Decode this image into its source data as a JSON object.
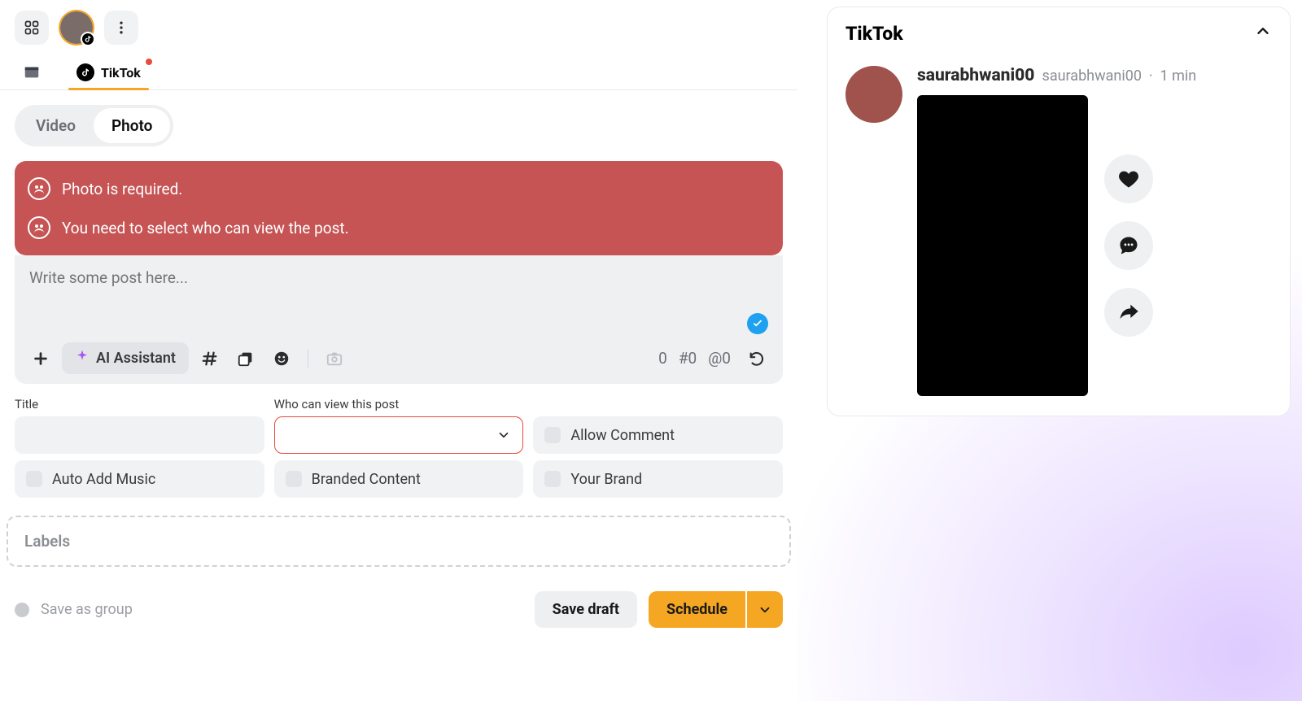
{
  "header": {
    "grid_label": "Accounts grid"
  },
  "tabs": {
    "calendar_icon": "calendar",
    "active": "TikTok"
  },
  "content_type": {
    "video": "Video",
    "photo": "Photo",
    "active": "Photo"
  },
  "errors": [
    "Photo is required.",
    "You need to select who can view the post."
  ],
  "composer": {
    "placeholder": "Write some post here...",
    "ai_button": "AI Assistant",
    "counts": {
      "chars": "0",
      "hash": "#0",
      "at": "@0"
    }
  },
  "form": {
    "title_label": "Title",
    "view_label": "Who can view this post",
    "allow_comment": "Allow Comment",
    "auto_add_music": "Auto Add Music",
    "branded_content": "Branded Content",
    "your_brand": "Your Brand"
  },
  "labels_box": "Labels",
  "footer": {
    "save_group": "Save as group",
    "save_draft": "Save draft",
    "schedule": "Schedule"
  },
  "preview": {
    "title": "TikTok",
    "username": "saurabhwani00",
    "handle": "saurabhwani00",
    "time": "1 min"
  }
}
